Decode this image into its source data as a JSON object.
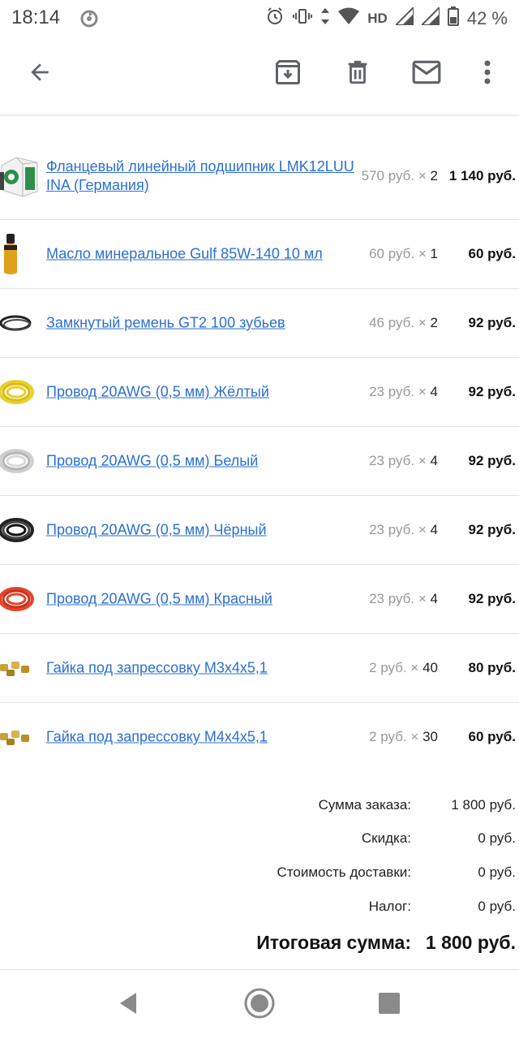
{
  "status_bar": {
    "time": "18:14",
    "network": "HD",
    "battery": "42 %",
    "icons": [
      "sync-icon",
      "alarm-icon",
      "vibrate-icon",
      "data-arrows-icon",
      "wifi-icon",
      "signal-icon",
      "signal-icon",
      "battery-icon"
    ]
  },
  "toolbar": {
    "icons": [
      "arrow-back-icon",
      "archive-icon",
      "delete-icon",
      "mail-icon",
      "more-vert-icon"
    ]
  },
  "items": [
    {
      "name": "Фланцевый линейный подшипник LMK12LUU INA (Германия)",
      "unit_price": "570 руб.",
      "times": "×",
      "qty": "2",
      "total": "1 140 руб.",
      "thumb": "bearing-box"
    },
    {
      "name": "Масло минеральное Gulf 85W-140 10 мл",
      "unit_price": "60 руб.",
      "times": "×",
      "qty": "1",
      "total": "60 руб.",
      "thumb": "oil-bottle"
    },
    {
      "name": "Замкнутый ремень GT2 100 зубьев",
      "unit_price": "46 руб.",
      "times": "×",
      "qty": "2",
      "total": "92 руб.",
      "thumb": "belt"
    },
    {
      "name": "Провод 20AWG (0,5 мм) Жёлтый",
      "unit_price": "23 руб.",
      "times": "×",
      "qty": "4",
      "total": "92 руб.",
      "thumb": "wire",
      "color": "#e8d02a"
    },
    {
      "name": "Провод 20AWG (0,5 мм) Белый",
      "unit_price": "23 руб.",
      "times": "×",
      "qty": "4",
      "total": "92 руб.",
      "thumb": "wire",
      "color": "#d8d8d8"
    },
    {
      "name": "Провод 20AWG (0,5 мм) Чёрный",
      "unit_price": "23 руб.",
      "times": "×",
      "qty": "4",
      "total": "92 руб.",
      "thumb": "wire",
      "color": "#222222"
    },
    {
      "name": "Провод 20AWG (0,5 мм) Красный",
      "unit_price": "23 руб.",
      "times": "×",
      "qty": "4",
      "total": "92 руб.",
      "thumb": "wire",
      "color": "#e5442a"
    },
    {
      "name": "Гайка под запрессовку М3х4х5,1",
      "unit_price": "2 руб.",
      "times": "×",
      "qty": "40",
      "total": "80 руб.",
      "thumb": "nuts"
    },
    {
      "name": "Гайка под запрессовку М4х4х5,1",
      "unit_price": "2 руб.",
      "times": "×",
      "qty": "30",
      "total": "60 руб.",
      "thumb": "nuts"
    }
  ],
  "summary": {
    "subtotal_label": "Сумма заказа:",
    "subtotal_value": "1 800 руб.",
    "discount_label": "Скидка:",
    "discount_value": "0 руб.",
    "shipping_label": "Стоимость доставки:",
    "shipping_value": "0 руб.",
    "tax_label": "Налог:",
    "tax_value": "0 руб.",
    "grand_label": "Итоговая сумма:",
    "grand_value": "1 800 руб."
  },
  "nav_bar": {
    "icons": [
      "back-triangle-icon",
      "home-circle-icon",
      "recents-square-icon"
    ]
  },
  "colors": {
    "link": "#2a6fd6",
    "icon": "#5f6368",
    "muted": "#999999",
    "divider": "#e3e3e3"
  }
}
